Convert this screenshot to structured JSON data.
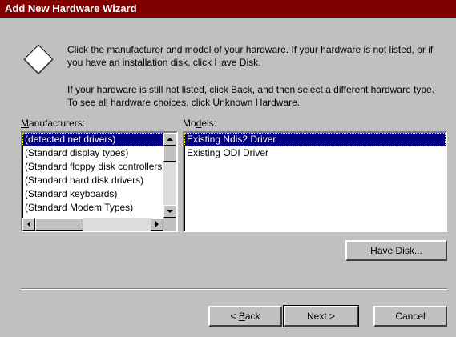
{
  "window": {
    "title": "Add New Hardware Wizard"
  },
  "icons": {
    "wizard": "diamond-icon",
    "scroll_up": "arrow-up-icon",
    "scroll_down": "arrow-down-icon",
    "scroll_left": "arrow-left-icon",
    "scroll_right": "arrow-right-icon"
  },
  "instructions": {
    "p1": "Click the manufacturer and model of your hardware. If your hardware is not listed, or if you have an installation disk, click Have Disk.",
    "p2": "If your hardware is still not listed, click Back, and then select a different hardware type. To see all hardware choices, click Unknown Hardware."
  },
  "manufacturers": {
    "label_first": "M",
    "label_rest": "anufacturers:",
    "items": [
      "(detected net drivers)",
      "(Standard display types)",
      "(Standard floppy disk controllers)",
      "(Standard hard disk drivers)",
      "(Standard keyboards)",
      "(Standard Modem Types)"
    ],
    "selected_index": 0
  },
  "models": {
    "label_pre": "Mo",
    "label_u": "d",
    "label_post": "els:",
    "items": [
      "Existing Ndis2 Driver",
      "Existing ODI Driver"
    ],
    "selected_index": 0
  },
  "buttons": {
    "have_disk_u": "H",
    "have_disk_rest": "ave Disk...",
    "back_pre": "< ",
    "back_u": "B",
    "back_rest": "ack",
    "next": "Next >",
    "cancel": "Cancel"
  },
  "colors": {
    "titlebar": "#800000",
    "selection": "#000080",
    "face": "#c0c0c0"
  }
}
